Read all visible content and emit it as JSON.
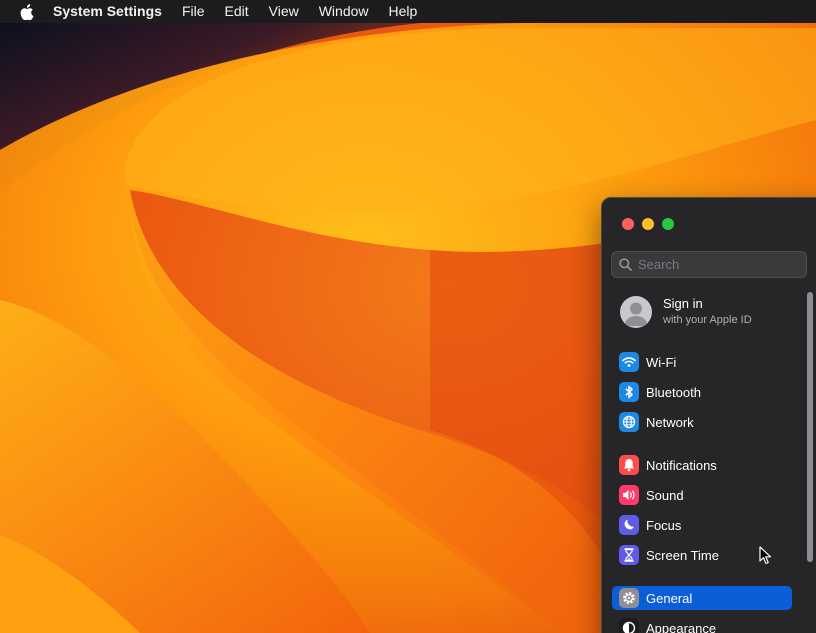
{
  "menubar": {
    "apple_icon": "apple-logo-icon",
    "app_name": "System Settings",
    "items": [
      "File",
      "Edit",
      "View",
      "Window",
      "Help"
    ]
  },
  "window": {
    "search_placeholder": "Search",
    "account": {
      "title": "Sign in",
      "subtitle": "with your Apple ID",
      "icon": "user-avatar-icon"
    },
    "items": [
      {
        "label": "Wi-Fi",
        "icon": "wifi-icon",
        "color": "#1e88e5"
      },
      {
        "label": "Bluetooth",
        "icon": "bluetooth-icon",
        "color": "#1e88e5"
      },
      {
        "label": "Network",
        "icon": "globe-icon",
        "color": "#1e88e5"
      },
      {
        "label": "Notifications",
        "icon": "bell-icon",
        "color": "#ff4b4b"
      },
      {
        "label": "Sound",
        "icon": "speaker-icon",
        "color": "#ff3b6b"
      },
      {
        "label": "Focus",
        "icon": "moon-icon",
        "color": "#5e5ce6"
      },
      {
        "label": "Screen Time",
        "icon": "hourglass-icon",
        "color": "#5e5ce6"
      },
      {
        "label": "General",
        "icon": "gear-icon",
        "color": "#8e8e93",
        "selected": true
      },
      {
        "label": "Appearance",
        "icon": "appearance-icon",
        "color": "#1c1c1e"
      }
    ]
  },
  "colors": {
    "menubar_bg": "#1c1c1e",
    "window_bg": "#262628",
    "selection": "#0a5fd8"
  }
}
